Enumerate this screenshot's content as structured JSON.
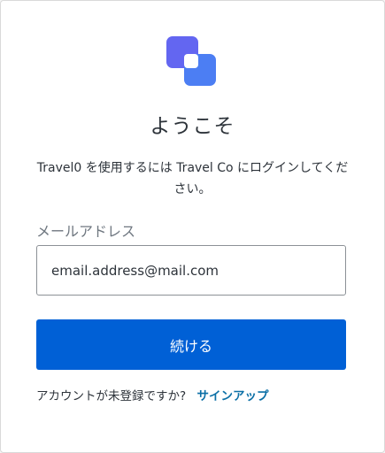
{
  "login": {
    "title": "ようこそ",
    "subtitle": "Travel0 を使用するには Travel Co にログインしてください。",
    "email_label": "メールアドレス",
    "email_value": "email.address@mail.com",
    "continue_label": "続ける",
    "signup_prompt": "アカウントが未登録ですか?",
    "signup_link": "サインアップ"
  },
  "icons": {
    "logo": "overlapping-squares-logo-icon"
  },
  "colors": {
    "logo_back": "#6366f1",
    "logo_front": "#4c7ef3",
    "button": "#0060d6",
    "link": "#0b6fa6",
    "text": "#2d333a",
    "label": "#6f7780"
  }
}
